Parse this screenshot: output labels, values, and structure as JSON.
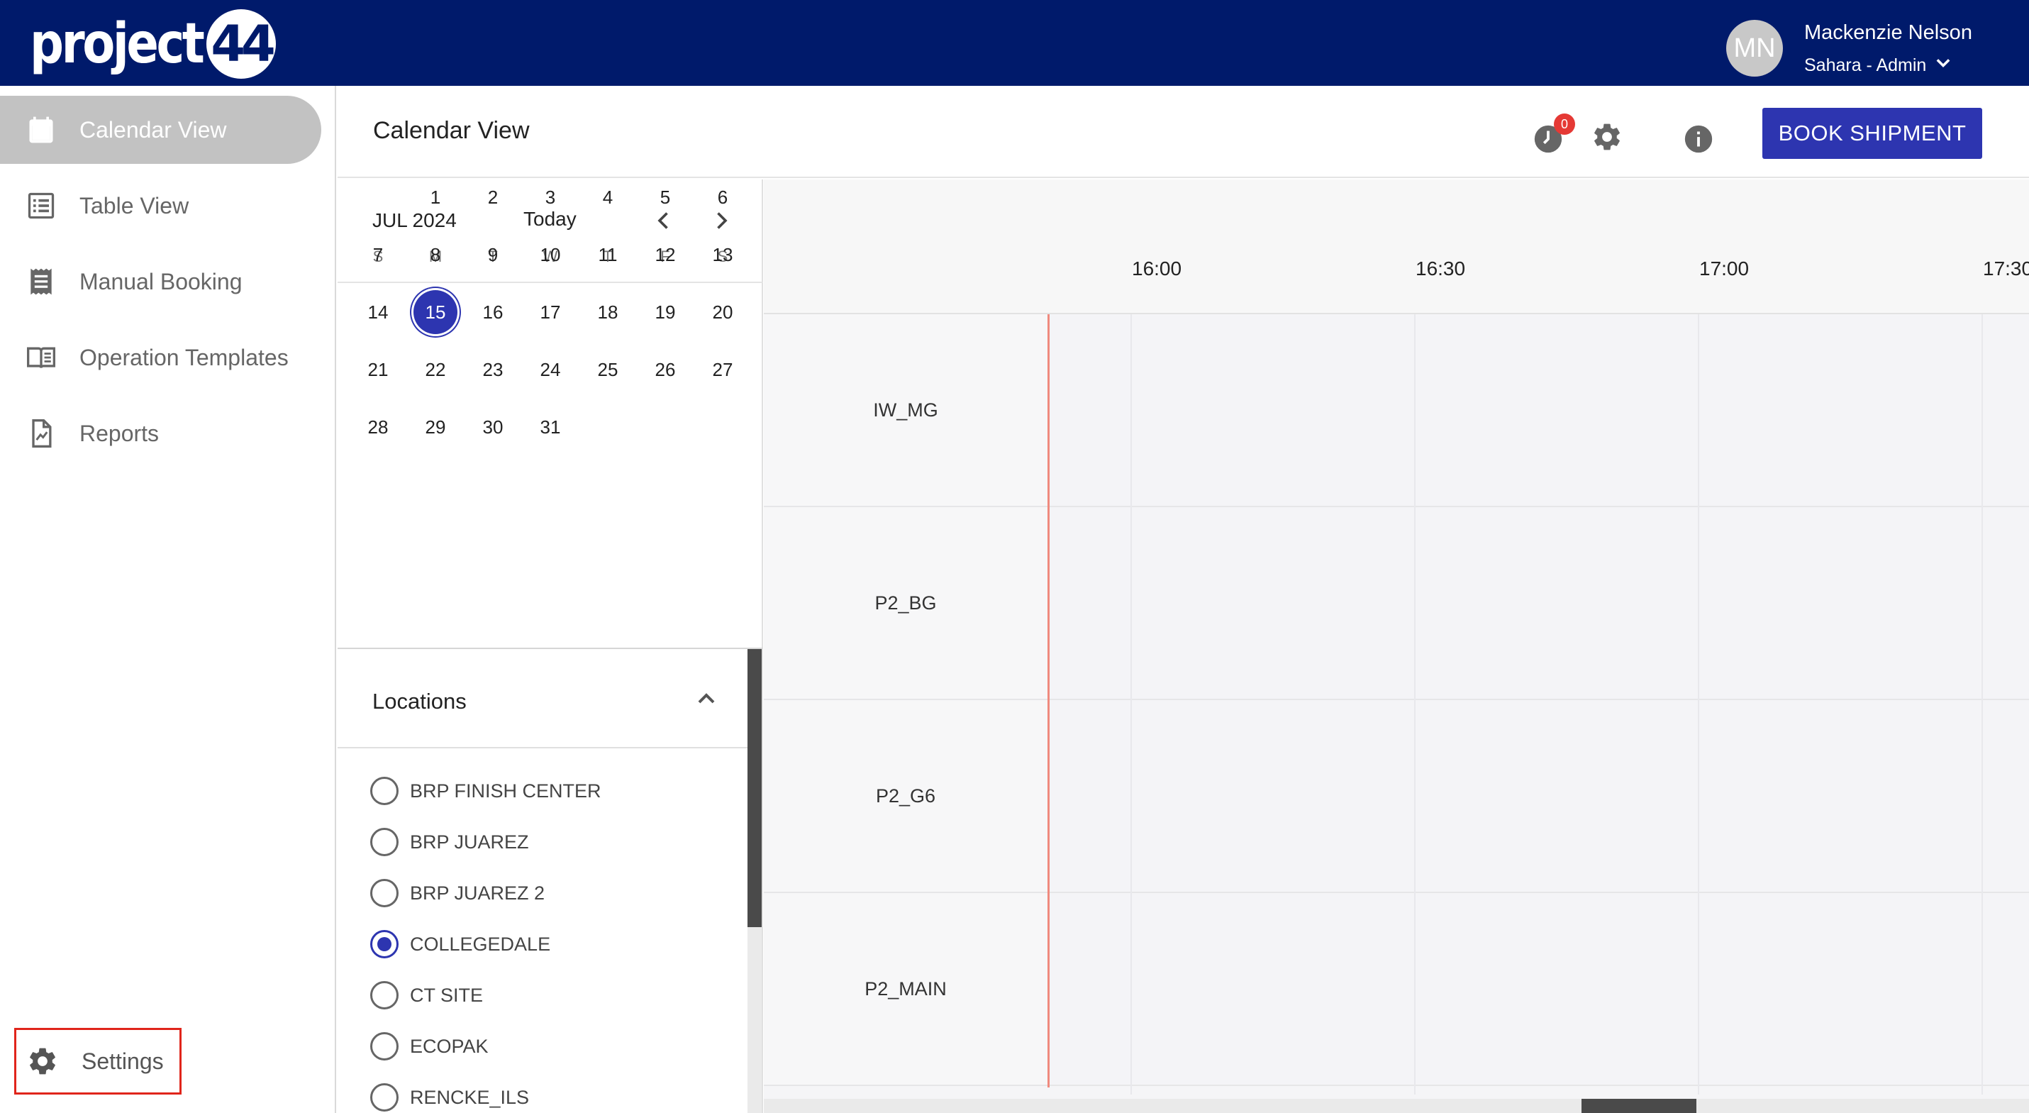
{
  "header": {
    "logo": {
      "text": "project",
      "badge": "44"
    },
    "user": {
      "initials": "MN",
      "name": "Mackenzie Nelson",
      "role": "Sahara - Admin"
    }
  },
  "sidebar": {
    "items": [
      {
        "label": "Calendar View",
        "icon": "calendar-icon",
        "active": true
      },
      {
        "label": "Table View",
        "icon": "list-icon",
        "active": false
      },
      {
        "label": "Manual Booking",
        "icon": "receipt-icon",
        "active": false
      },
      {
        "label": "Operation Templates",
        "icon": "book-icon",
        "active": false
      },
      {
        "label": "Reports",
        "icon": "report-icon",
        "active": false
      }
    ],
    "settings_label": "Settings"
  },
  "page": {
    "title": "Calendar View",
    "notification_count": "0",
    "book_button": "BOOK SHIPMENT"
  },
  "calendar": {
    "month": "JUL 2024",
    "today_label": "Today",
    "weekdays": [
      "S",
      "M",
      "T",
      "W",
      "T",
      "F",
      "S"
    ],
    "selected_day": 15,
    "weeks": [
      [
        "",
        "1",
        "2",
        "3",
        "4",
        "5",
        "6"
      ],
      [
        "7",
        "8",
        "9",
        "10",
        "11",
        "12",
        "13"
      ],
      [
        "14",
        "15",
        "16",
        "17",
        "18",
        "19",
        "20"
      ],
      [
        "21",
        "22",
        "23",
        "24",
        "25",
        "26",
        "27"
      ],
      [
        "28",
        "29",
        "30",
        "31",
        "",
        "",
        ""
      ]
    ]
  },
  "locations": {
    "title": "Locations",
    "items": [
      {
        "label": "BRP FINISH CENTER",
        "checked": false
      },
      {
        "label": "BRP JUAREZ",
        "checked": false
      },
      {
        "label": "BRP JUAREZ 2",
        "checked": false
      },
      {
        "label": "COLLEGEDALE",
        "checked": true
      },
      {
        "label": "CT SITE",
        "checked": false
      },
      {
        "label": "ECOPAK",
        "checked": false
      },
      {
        "label": "RENCKE_ILS",
        "checked": false
      }
    ]
  },
  "schedule": {
    "times": [
      "16:00",
      "16:30",
      "17:00",
      "17:30"
    ],
    "resources": [
      "IW_MG",
      "P2_BG",
      "P2_G6",
      "P2_MAIN"
    ]
  },
  "colors": {
    "topbar": "#001a6b",
    "accent": "#2d35b0",
    "now_line": "#f08a7e",
    "badge": "#e53935"
  }
}
